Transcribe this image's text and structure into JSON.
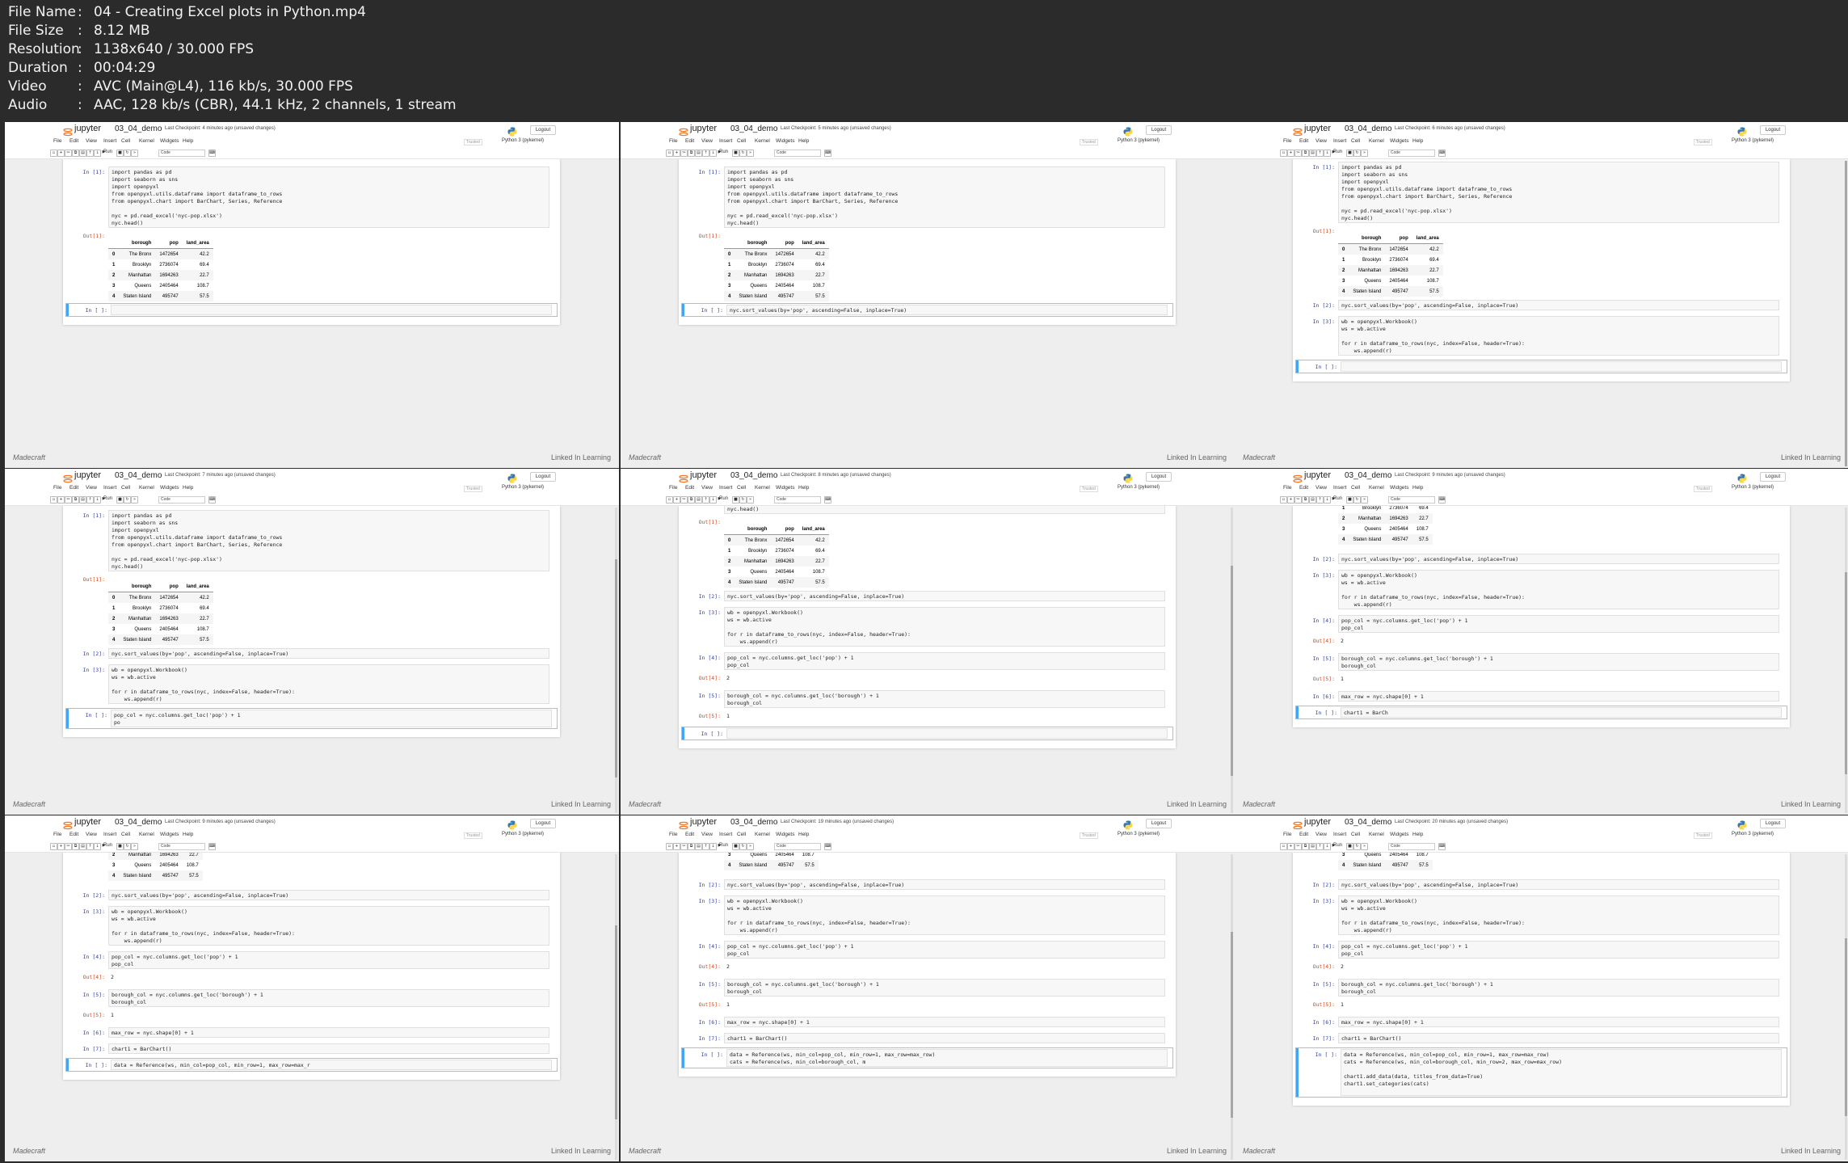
{
  "info": {
    "rows": [
      {
        "key": "File Name",
        "value": "04 - Creating Excel plots in Python.mp4"
      },
      {
        "key": "File Size",
        "value": "8.12 MB"
      },
      {
        "key": "Resolution",
        "value": "1138x640 / 30.000 FPS"
      },
      {
        "key": "Duration",
        "value": "00:04:29"
      },
      {
        "key": "Video",
        "value": "AVC (Main@L4), 116 kb/s, 30.000 FPS"
      },
      {
        "key": "Audio",
        "value": "AAC, 128 kb/s (CBR), 44.1 kHz, 2 channels, 1 stream"
      }
    ]
  },
  "jupyter": {
    "brand": "jupyter",
    "notebook": "03_04_demo",
    "unsaved": "(unsaved changes)",
    "logout": "Logout",
    "menu": [
      "File",
      "Edit",
      "View",
      "Insert",
      "Cell",
      "Kernel",
      "Widgets",
      "Help"
    ],
    "trusted": "Trusted",
    "kernel": "Python 3 (pykernel)",
    "run": "Run",
    "celltype": "Code",
    "wm_left": "Madecraft",
    "wm_right": "Linked In Learning"
  },
  "df": {
    "cols": [
      "",
      "borough",
      "pop",
      "land_area"
    ],
    "rows": [
      [
        "0",
        "The Bronx",
        "1472654",
        "42.2"
      ],
      [
        "1",
        "Brooklyn",
        "2736074",
        "69.4"
      ],
      [
        "2",
        "Manhattan",
        "1694263",
        "22.7"
      ],
      [
        "3",
        "Queens",
        "2405464",
        "108.7"
      ],
      [
        "4",
        "Staten Island",
        "495747",
        "57.5"
      ]
    ]
  },
  "frames": [
    {
      "checkpoint": "Last Checkpoint: 4 minutes ago",
      "cells": [
        {
          "kind": "code",
          "prompt": "In [1]:",
          "lines": [
            "import pandas as pd",
            "import seaborn as sns",
            "import openpyxl",
            "from openpyxl.utils.dataframe import dataframe_to_rows",
            "from openpyxl.chart import BarChart, Series, Reference",
            "",
            "nyc = pd.read_excel('nyc-pop.xlsx')",
            "nyc.head()"
          ]
        },
        {
          "kind": "df",
          "prompt": "Out[1]:",
          "rows": 5
        },
        {
          "kind": "code",
          "prompt": "In [ ]:",
          "lines": [
            ""
          ],
          "selected": true
        }
      ]
    },
    {
      "checkpoint": "Last Checkpoint: 5 minutes ago",
      "cells": [
        {
          "kind": "code",
          "prompt": "In [1]:",
          "lines": [
            "import pandas as pd",
            "import seaborn as sns",
            "import openpyxl",
            "from openpyxl.utils.dataframe import dataframe_to_rows",
            "from openpyxl.chart import BarChart, Series, Reference",
            "",
            "nyc = pd.read_excel('nyc-pop.xlsx')",
            "nyc.head()"
          ]
        },
        {
          "kind": "df",
          "prompt": "Out[1]:",
          "rows": 5
        },
        {
          "kind": "code",
          "prompt": "In [ ]:",
          "lines": [
            "nyc.sort_values(by='pop', ascending=False, inplace=True)"
          ],
          "selected": true
        }
      ]
    },
    {
      "checkpoint": "Last Checkpoint: 6 minutes ago",
      "cells": [
        {
          "kind": "code",
          "prompt": "In [1]:",
          "lines": [
            "import pandas as pd",
            "import seaborn as sns",
            "import openpyxl",
            "from openpyxl.utils.dataframe import dataframe_to_rows",
            "from openpyxl.chart import BarChart, Series, Reference",
            "",
            "nyc = pd.read_excel('nyc-pop.xlsx')",
            "nyc.head()"
          ]
        },
        {
          "kind": "df",
          "prompt": "Out[1]:",
          "rows": 5
        },
        {
          "kind": "code",
          "prompt": "In [2]:",
          "lines": [
            "nyc.sort_values(by='pop', ascending=False, inplace=True)"
          ]
        },
        {
          "kind": "code",
          "prompt": "In [3]:",
          "lines": [
            "wb = openpyxl.Workbook()",
            "ws = wb.active",
            "",
            "for r in dataframe_to_rows(nyc, index=False, header=True):",
            "    ws.append(r)"
          ]
        },
        {
          "kind": "code",
          "prompt": "In [ ]:",
          "lines": [
            ""
          ],
          "selected": true
        }
      ]
    },
    {
      "checkpoint": "Last Checkpoint: 7 minutes ago",
      "cells": [
        {
          "kind": "code",
          "prompt": "In [1]:",
          "lines": [
            "import pandas as pd",
            "import seaborn as sns",
            "import openpyxl",
            "from openpyxl.utils.dataframe import dataframe_to_rows",
            "from openpyxl.chart import BarChart, Series, Reference",
            "",
            "nyc = pd.read_excel('nyc-pop.xlsx')",
            "nyc.head()"
          ]
        },
        {
          "kind": "df",
          "prompt": "Out[1]:",
          "rows": 5
        },
        {
          "kind": "code",
          "prompt": "In [2]:",
          "lines": [
            "nyc.sort_values(by='pop', ascending=False, inplace=True)"
          ]
        },
        {
          "kind": "code",
          "prompt": "In [3]:",
          "lines": [
            "wb = openpyxl.Workbook()",
            "ws = wb.active",
            "",
            "for r in dataframe_to_rows(nyc, index=False, header=True):",
            "    ws.append(r)"
          ]
        },
        {
          "kind": "code",
          "prompt": "In [ ]:",
          "lines": [
            "pop_col = nyc.columns.get_loc('pop') + 1",
            "po"
          ],
          "selected": true
        }
      ]
    },
    {
      "checkpoint": "Last Checkpoint: 8 minutes ago",
      "cells": [
        {
          "kind": "code",
          "prompt": "",
          "lines": [
            "nyc.head()"
          ]
        },
        {
          "kind": "df",
          "prompt": "Out[1]:",
          "rows": 5
        },
        {
          "kind": "code",
          "prompt": "In [2]:",
          "lines": [
            "nyc.sort_values(by='pop', ascending=False, inplace=True)"
          ]
        },
        {
          "kind": "code",
          "prompt": "In [3]:",
          "lines": [
            "wb = openpyxl.Workbook()",
            "ws = wb.active",
            "",
            "for r in dataframe_to_rows(nyc, index=False, header=True):",
            "    ws.append(r)"
          ]
        },
        {
          "kind": "code",
          "prompt": "In [4]:",
          "lines": [
            "pop_col = nyc.columns.get_loc('pop') + 1",
            "pop_col"
          ]
        },
        {
          "kind": "out",
          "prompt": "Out[4]:",
          "text": "2"
        },
        {
          "kind": "code",
          "prompt": "In [5]:",
          "lines": [
            "borough_col = nyc.columns.get_loc('borough') + 1",
            "borough_col"
          ]
        },
        {
          "kind": "out",
          "prompt": "Out[5]:",
          "text": "1"
        },
        {
          "kind": "code",
          "prompt": "In [ ]:",
          "lines": [
            ""
          ],
          "selected": true
        }
      ]
    },
    {
      "checkpoint": "Last Checkpoint: 9 minutes ago",
      "cells": [
        {
          "kind": "df",
          "prompt": "",
          "rows": 4,
          "from": 1
        },
        {
          "kind": "code",
          "prompt": "In [2]:",
          "lines": [
            "nyc.sort_values(by='pop', ascending=False, inplace=True)"
          ]
        },
        {
          "kind": "code",
          "prompt": "In [3]:",
          "lines": [
            "wb = openpyxl.Workbook()",
            "ws = wb.active",
            "",
            "for r in dataframe_to_rows(nyc, index=False, header=True):",
            "    ws.append(r)"
          ]
        },
        {
          "kind": "code",
          "prompt": "In [4]:",
          "lines": [
            "pop_col = nyc.columns.get_loc('pop') + 1",
            "pop_col"
          ]
        },
        {
          "kind": "out",
          "prompt": "Out[4]:",
          "text": "2"
        },
        {
          "kind": "code",
          "prompt": "In [5]:",
          "lines": [
            "borough_col = nyc.columns.get_loc('borough') + 1",
            "borough_col"
          ]
        },
        {
          "kind": "out",
          "prompt": "Out[5]:",
          "text": "1"
        },
        {
          "kind": "code",
          "prompt": "In [6]:",
          "lines": [
            "max_row = nyc.shape[0] + 1"
          ]
        },
        {
          "kind": "code",
          "prompt": "In [ ]:",
          "lines": [
            "chart1 = BarCh"
          ],
          "selected": true
        }
      ]
    },
    {
      "checkpoint": "Last Checkpoint: 9 minutes ago",
      "cells": [
        {
          "kind": "df",
          "prompt": "",
          "rows": 3,
          "from": 2
        },
        {
          "kind": "code",
          "prompt": "In [2]:",
          "lines": [
            "nyc.sort_values(by='pop', ascending=False, inplace=True)"
          ]
        },
        {
          "kind": "code",
          "prompt": "In [3]:",
          "lines": [
            "wb = openpyxl.Workbook()",
            "ws = wb.active",
            "",
            "for r in dataframe_to_rows(nyc, index=False, header=True):",
            "    ws.append(r)"
          ]
        },
        {
          "kind": "code",
          "prompt": "In [4]:",
          "lines": [
            "pop_col = nyc.columns.get_loc('pop') + 1",
            "pop_col"
          ]
        },
        {
          "kind": "out",
          "prompt": "Out[4]:",
          "text": "2"
        },
        {
          "kind": "code",
          "prompt": "In [5]:",
          "lines": [
            "borough_col = nyc.columns.get_loc('borough') + 1",
            "borough_col"
          ]
        },
        {
          "kind": "out",
          "prompt": "Out[5]:",
          "text": "1"
        },
        {
          "kind": "code",
          "prompt": "In [6]:",
          "lines": [
            "max_row = nyc.shape[0] + 1"
          ]
        },
        {
          "kind": "code",
          "prompt": "In [7]:",
          "lines": [
            "chart1 = BarChart()"
          ]
        },
        {
          "kind": "code",
          "prompt": "In [ ]:",
          "lines": [
            "data = Reference(ws, min_col=pop_col, min_row=1, max_row=max_r"
          ],
          "selected": true
        }
      ]
    },
    {
      "checkpoint": "Last Checkpoint: 19 minutes ago",
      "cells": [
        {
          "kind": "df",
          "prompt": "",
          "rows": 2,
          "from": 3
        },
        {
          "kind": "code",
          "prompt": "In [2]:",
          "lines": [
            "nyc.sort_values(by='pop', ascending=False, inplace=True)"
          ]
        },
        {
          "kind": "code",
          "prompt": "In [3]:",
          "lines": [
            "wb = openpyxl.Workbook()",
            "ws = wb.active",
            "",
            "for r in dataframe_to_rows(nyc, index=False, header=True):",
            "    ws.append(r)"
          ]
        },
        {
          "kind": "code",
          "prompt": "In [4]:",
          "lines": [
            "pop_col = nyc.columns.get_loc('pop') + 1",
            "pop_col"
          ]
        },
        {
          "kind": "out",
          "prompt": "Out[4]:",
          "text": "2"
        },
        {
          "kind": "code",
          "prompt": "In [5]:",
          "lines": [
            "borough_col = nyc.columns.get_loc('borough') + 1",
            "borough_col"
          ]
        },
        {
          "kind": "out",
          "prompt": "Out[5]:",
          "text": "1"
        },
        {
          "kind": "code",
          "prompt": "In [6]:",
          "lines": [
            "max_row = nyc.shape[0] + 1"
          ]
        },
        {
          "kind": "code",
          "prompt": "In [7]:",
          "lines": [
            "chart1 = BarChart()"
          ]
        },
        {
          "kind": "code",
          "prompt": "In [ ]:",
          "lines": [
            "data = Reference(ws, min_col=pop_col, min_row=1, max_row=max_row)",
            "cats = Reference(ws, min_col=borough_col, m"
          ],
          "selected": true
        }
      ]
    },
    {
      "checkpoint": "Last Checkpoint: 20 minutes ago",
      "cells": [
        {
          "kind": "df",
          "prompt": "",
          "rows": 2,
          "from": 3
        },
        {
          "kind": "code",
          "prompt": "In [2]:",
          "lines": [
            "nyc.sort_values(by='pop', ascending=False, inplace=True)"
          ]
        },
        {
          "kind": "code",
          "prompt": "In [3]:",
          "lines": [
            "wb = openpyxl.Workbook()",
            "ws = wb.active",
            "",
            "for r in dataframe_to_rows(nyc, index=False, header=True):",
            "    ws.append(r)"
          ]
        },
        {
          "kind": "code",
          "prompt": "In [4]:",
          "lines": [
            "pop_col = nyc.columns.get_loc('pop') + 1",
            "pop_col"
          ]
        },
        {
          "kind": "out",
          "prompt": "Out[4]:",
          "text": "2"
        },
        {
          "kind": "code",
          "prompt": "In [5]:",
          "lines": [
            "borough_col = nyc.columns.get_loc('borough') + 1",
            "borough_col"
          ]
        },
        {
          "kind": "out",
          "prompt": "Out[5]:",
          "text": "1"
        },
        {
          "kind": "code",
          "prompt": "In [6]:",
          "lines": [
            "max_row = nyc.shape[0] + 1"
          ]
        },
        {
          "kind": "code",
          "prompt": "In [7]:",
          "lines": [
            "chart1 = BarChart()"
          ]
        },
        {
          "kind": "code",
          "prompt": "In [ ]:",
          "lines": [
            "data = Reference(ws, min_col=pop_col, min_row=1, max_row=max_row)",
            "cats = Reference(ws, min_col=borough_col, min_row=2, max_row=max_row)",
            "",
            "chart1.add_data(data, titles_from_data=True)",
            "chart1.set_categories(cats)",
            ""
          ],
          "selected": true
        }
      ]
    }
  ]
}
